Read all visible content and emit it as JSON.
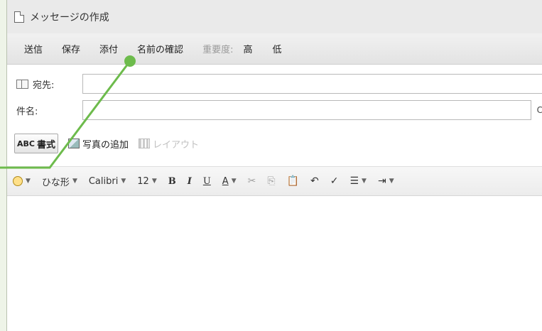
{
  "window": {
    "title": "メッセージの作成"
  },
  "commands": {
    "send": "送信",
    "save": "保存",
    "attach": "添付",
    "check_names": "名前の確認",
    "importance_label": "重要度:",
    "importance_high": "高",
    "importance_low": "低"
  },
  "fields": {
    "to_label": "宛先:",
    "to_value": "",
    "subject_label": "件名:",
    "subject_value": "",
    "cc_hint": "C"
  },
  "tools": {
    "format": "書式",
    "format_icon_text": "ABC",
    "add_photo": "写真の追加",
    "layout": "レイアウト"
  },
  "formatting": {
    "template": "ひな形",
    "font": "Calibri",
    "size": "12",
    "bold": "B",
    "italic": "I",
    "underline": "U",
    "font_color": "A"
  },
  "callout": {
    "color": "#6dbb4c"
  }
}
